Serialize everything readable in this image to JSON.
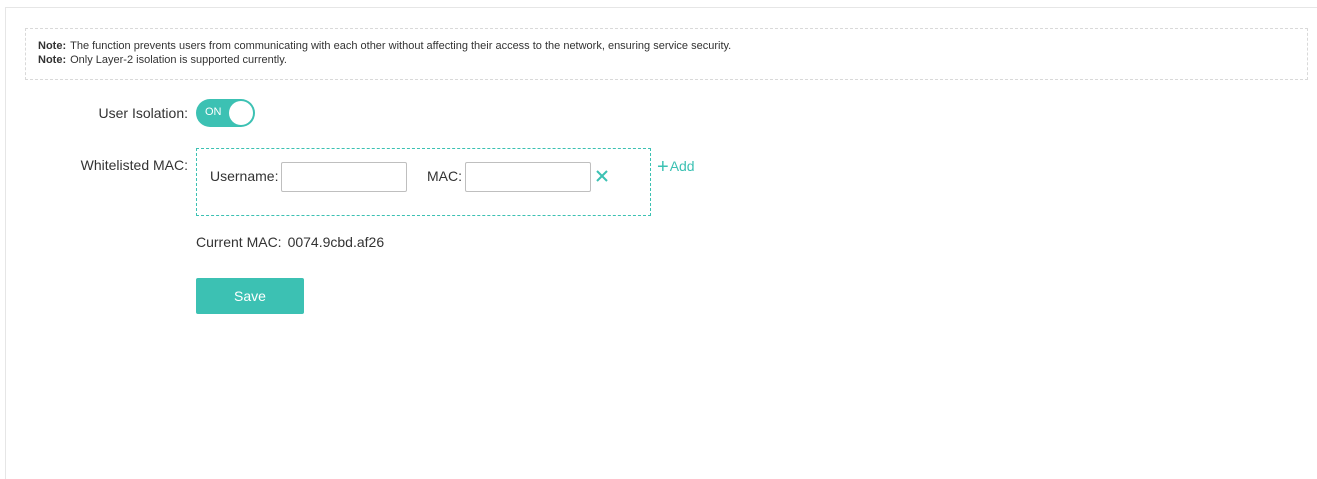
{
  "notes": [
    {
      "tag": "Note:",
      "text": "The function prevents users from communicating with each other without affecting their access to the network, ensuring service security."
    },
    {
      "tag": "Note:",
      "text": "Only Layer-2 isolation is supported currently."
    }
  ],
  "isolation": {
    "label": "User Isolation:",
    "toggle_text": "ON",
    "enabled": true
  },
  "whitelist": {
    "label": "Whitelisted MAC:",
    "username_label": "Username:",
    "username_value": "",
    "mac_label": "MAC:",
    "mac_value": "",
    "add_label": "Add",
    "add_icon": "plus-icon",
    "remove_icon": "close-icon"
  },
  "current_mac": {
    "label": "Current MAC:",
    "value": "0074.9cbd.af26"
  },
  "actions": {
    "save_label": "Save"
  },
  "colors": {
    "accent": "#3cc1b3"
  }
}
